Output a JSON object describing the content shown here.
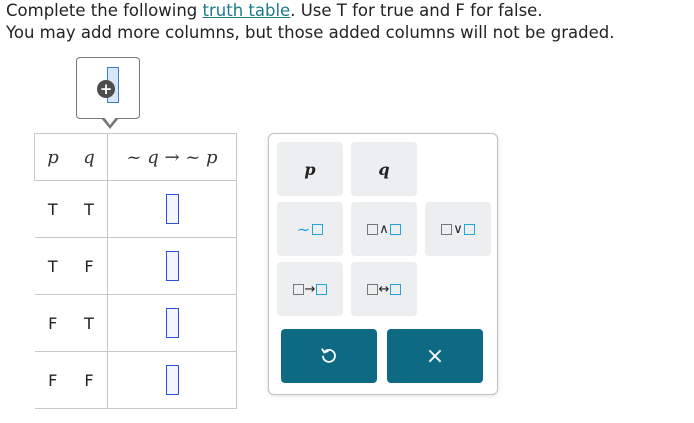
{
  "instructions": {
    "line1_before": "Complete the following ",
    "line1_link": "truth table",
    "line1_after": ". Use T for true and F for false.",
    "line2": "You may add more columns, but those added columns will not be graded."
  },
  "add_column": {
    "icon": "add-column-icon",
    "plus_symbol": "+"
  },
  "truth_table": {
    "headers": [
      "p",
      "q",
      "~ q → ~ p"
    ],
    "rows": [
      {
        "p": "T",
        "q": "T",
        "answer": ""
      },
      {
        "p": "T",
        "q": "F",
        "answer": ""
      },
      {
        "p": "F",
        "q": "T",
        "answer": ""
      },
      {
        "p": "F",
        "q": "F",
        "answer": ""
      }
    ]
  },
  "keypad": {
    "var_p": "p",
    "var_q": "q",
    "not_symbol": "~",
    "and_symbol": "∧",
    "or_symbol": "∨",
    "implies_symbol": "→",
    "iff_symbol": "↔",
    "undo_icon": "undo-icon",
    "clear_symbol": "×",
    "colors": {
      "action_bg": "#0e6a82",
      "key_bg": "#eceeef",
      "accent": "#22a3d9"
    }
  }
}
